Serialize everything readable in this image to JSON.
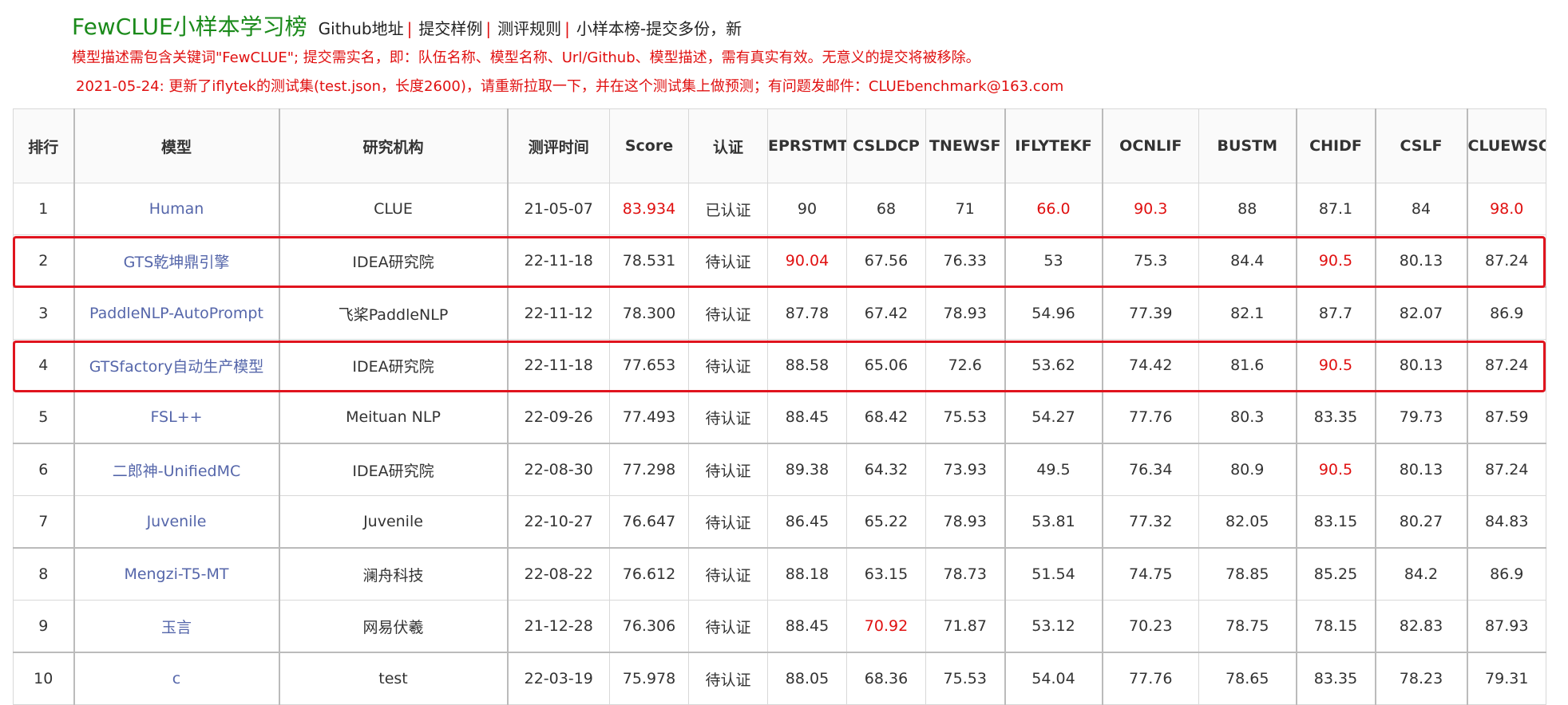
{
  "header": {
    "title": "FewCLUE小样本学习榜",
    "nav": [
      {
        "label": "Github地址"
      },
      {
        "label": "提交样例"
      },
      {
        "label": "测评规则"
      },
      {
        "label": "小样本榜-提交多份，新"
      }
    ],
    "separator": "|",
    "notice1": "模型描述需包含关键词\"FewCLUE\"; 提交需实名，即：队伍名称、模型名称、Url/Github、模型描述，需有真实有效。无意义的提交将被移除。",
    "notice2": "2021-05-24: 更新了iflytek的测试集(test.json，长度2600)，请重新拉取一下，并在这个测试集上做预测；有问题发邮件：CLUEbenchmark@163.com"
  },
  "colors": {
    "title_green": "#1a8a1a",
    "alert_red": "#e01010",
    "model_link": "#5566aa",
    "highlight_box": "#e0141e"
  },
  "table": {
    "columns": [
      "排行",
      "模型",
      "研究机构",
      "测评时间",
      "Score",
      "认证",
      "EPRSTMT",
      "CSLDCP",
      "TNEWSF",
      "IFLYTEKF",
      "OCNLIF",
      "BUSTM",
      "CHIDF",
      "CSLF",
      "CLUEWSCF"
    ],
    "rows": [
      {
        "cells": [
          "1",
          "Human",
          "CLUE",
          "21-05-07",
          "83.934",
          "已认证",
          "90",
          "68",
          "71",
          "66.0",
          "90.3",
          "88",
          "87.1",
          "84",
          "98.0"
        ],
        "red": [
          4,
          9,
          10,
          14
        ],
        "highlighted": false
      },
      {
        "cells": [
          "2",
          "GTS乾坤鼎引擎",
          "IDEA研究院",
          "22-11-18",
          "78.531",
          "待认证",
          "90.04",
          "67.56",
          "76.33",
          "53",
          "75.3",
          "84.4",
          "90.5",
          "80.13",
          "87.24"
        ],
        "red": [
          6,
          12
        ],
        "highlighted": true
      },
      {
        "cells": [
          "3",
          "PaddleNLP-AutoPrompt",
          "飞桨PaddleNLP",
          "22-11-12",
          "78.300",
          "待认证",
          "87.78",
          "67.42",
          "78.93",
          "54.96",
          "77.39",
          "82.1",
          "87.7",
          "82.07",
          "86.9"
        ],
        "red": [],
        "highlighted": false
      },
      {
        "cells": [
          "4",
          "GTSfactory自动生产模型",
          "IDEA研究院",
          "22-11-18",
          "77.653",
          "待认证",
          "88.58",
          "65.06",
          "72.6",
          "53.62",
          "74.42",
          "81.6",
          "90.5",
          "80.13",
          "87.24"
        ],
        "red": [
          12
        ],
        "highlighted": true
      },
      {
        "cells": [
          "5",
          "FSL++",
          "Meituan NLP",
          "22-09-26",
          "77.493",
          "待认证",
          "88.45",
          "68.42",
          "75.53",
          "54.27",
          "77.76",
          "80.3",
          "83.35",
          "79.73",
          "87.59"
        ],
        "red": [],
        "highlighted": false
      },
      {
        "cells": [
          "6",
          "二郎神-UnifiedMC",
          "IDEA研究院",
          "22-08-30",
          "77.298",
          "待认证",
          "89.38",
          "64.32",
          "73.93",
          "49.5",
          "76.34",
          "80.9",
          "90.5",
          "80.13",
          "87.24"
        ],
        "red": [
          12
        ],
        "highlighted": false
      },
      {
        "cells": [
          "7",
          "Juvenile",
          "Juvenile",
          "22-10-27",
          "76.647",
          "待认证",
          "86.45",
          "65.22",
          "78.93",
          "53.81",
          "77.32",
          "82.05",
          "83.15",
          "80.27",
          "84.83"
        ],
        "red": [],
        "highlighted": false
      },
      {
        "cells": [
          "8",
          "Mengzi-T5-MT",
          "澜舟科技",
          "22-08-22",
          "76.612",
          "待认证",
          "88.18",
          "63.15",
          "78.73",
          "51.54",
          "74.75",
          "78.85",
          "85.25",
          "84.2",
          "86.9"
        ],
        "red": [],
        "highlighted": false
      },
      {
        "cells": [
          "9",
          "玉言",
          "网易伏羲",
          "21-12-28",
          "76.306",
          "待认证",
          "88.45",
          "70.92",
          "71.87",
          "53.12",
          "70.23",
          "78.75",
          "78.15",
          "82.83",
          "87.93"
        ],
        "red": [
          7
        ],
        "highlighted": false
      },
      {
        "cells": [
          "10",
          "c",
          "test",
          "22-03-19",
          "75.978",
          "待认证",
          "88.05",
          "68.36",
          "75.53",
          "54.04",
          "77.76",
          "78.65",
          "83.35",
          "78.23",
          "79.31"
        ],
        "red": [],
        "highlighted": false
      }
    ]
  }
}
